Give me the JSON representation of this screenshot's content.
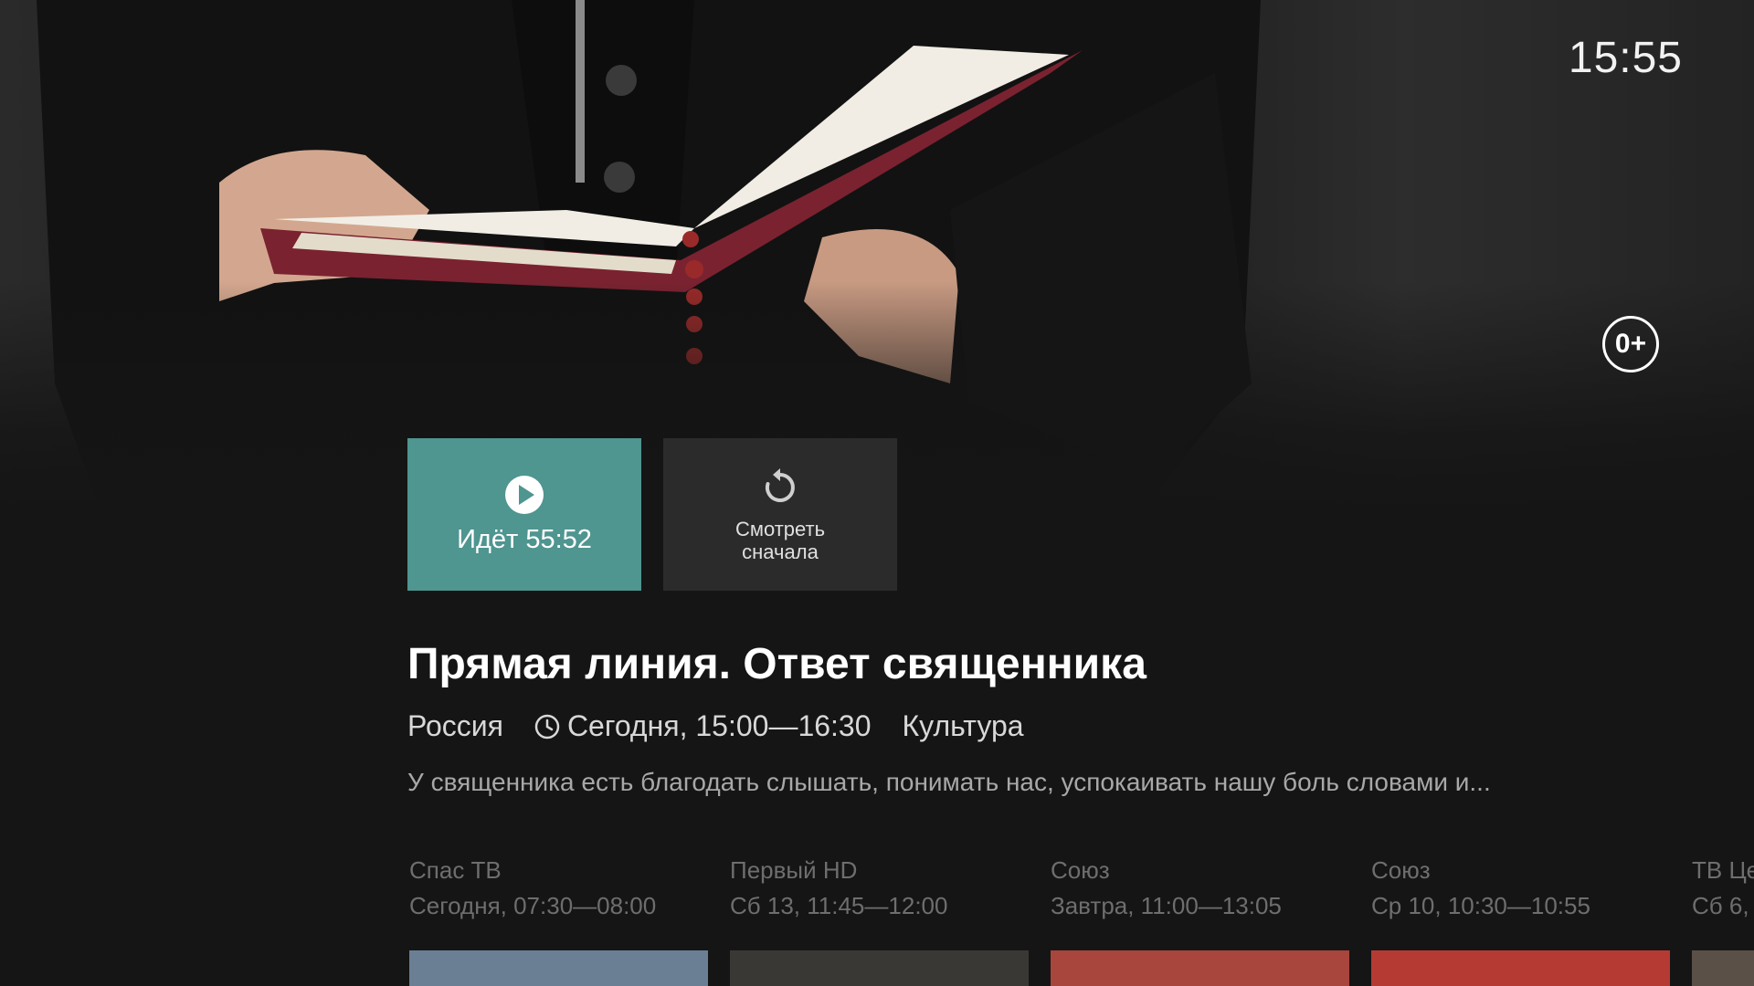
{
  "clock": "15:55",
  "age_rating": "0+",
  "buttons": {
    "play_label": "Идёт 55:52",
    "restart_label": "Смотреть сначала"
  },
  "program": {
    "title": "Прямая линия. Ответ священника",
    "country": "Россия",
    "time": "Сегодня, 15:00—16:30",
    "genre": "Культура",
    "description": "У священника есть благодать слышать, понимать нас, успокаивать нашу боль словами и..."
  },
  "airings": [
    {
      "channel": "Спас ТВ",
      "time": "Сегодня, 07:30—08:00",
      "thumb_color": "#6a7f94"
    },
    {
      "channel": "Первый HD",
      "time": "Сб 13, 11:45—12:00",
      "thumb_color": "#3a3835"
    },
    {
      "channel": "Союз",
      "time": "Завтра, 11:00—13:05",
      "thumb_color": "#a8453c"
    },
    {
      "channel": "Союз",
      "time": "Ср 10, 10:30—10:55",
      "thumb_color": "#b53a33"
    },
    {
      "channel": "ТВ Це",
      "time": "Сб 6, (",
      "thumb_color": "#5a5048"
    }
  ],
  "icons": {
    "play": "play-circle-icon",
    "restart": "restart-icon",
    "clock": "clock-icon"
  }
}
